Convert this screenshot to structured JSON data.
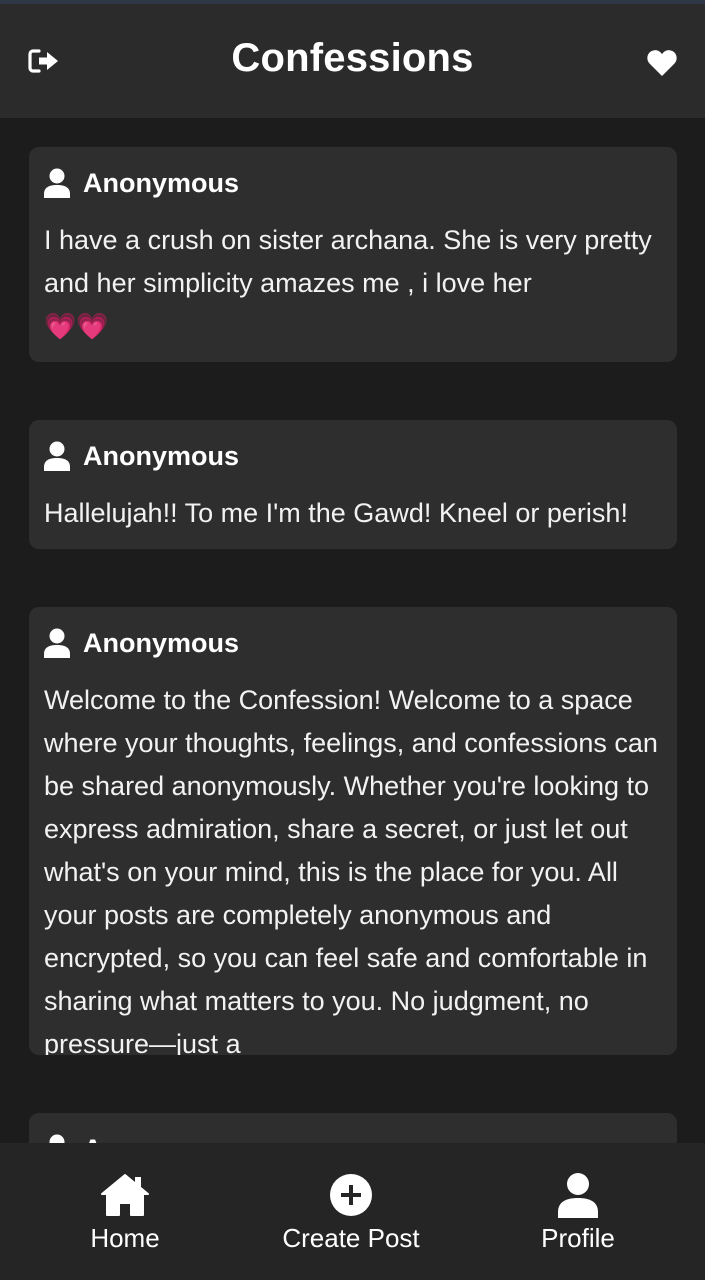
{
  "header": {
    "title": "Confessions",
    "logout_icon": "logout-icon",
    "favorites_icon": "heart-icon"
  },
  "posts": [
    {
      "author": "Anonymous",
      "text": "I have a crush on sister archana. She is very pretty and her simplicity amazes me , i love her",
      "emoji": "💗💗"
    },
    {
      "author": "Anonymous",
      "text": "Hallelujah!! To me I'm the Gawd! Kneel or perish!"
    },
    {
      "author": "Anonymous",
      "text": "Welcome to the Confession! Welcome to a space where your thoughts, feelings, and confessions can be shared anonymously. Whether you're looking to express admiration, share a secret, or just let out what's on your mind, this is the place for you. All your posts are completely anonymous and encrypted, so you can feel safe and comfortable in sharing what matters to you. No judgment, no pressure—just a"
    },
    {
      "author": "Anonymous",
      "text": ""
    }
  ],
  "tabbar": {
    "home": {
      "label": "Home",
      "icon": "home-icon"
    },
    "create": {
      "label": "Create Post",
      "icon": "plus-circle-icon"
    },
    "profile": {
      "label": "Profile",
      "icon": "user-icon"
    }
  },
  "colors": {
    "background": "#1c1c1c",
    "header": "#2b2b2b",
    "card": "#2e2e2e",
    "tabbar": "#252525",
    "text": "#ffffff",
    "emoji_heart": "#f0467f"
  }
}
